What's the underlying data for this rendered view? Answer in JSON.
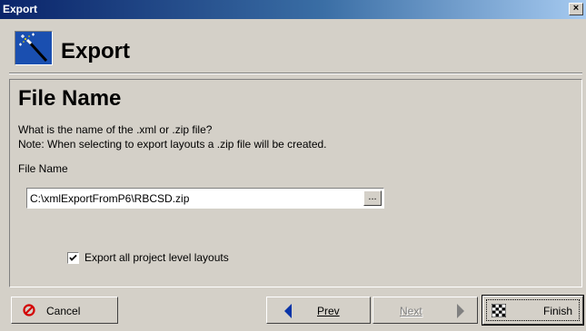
{
  "window": {
    "title": "Export",
    "close_label": "×"
  },
  "header": {
    "title": "Export"
  },
  "page": {
    "title": "File Name",
    "question": "What is the name of the .xml or .zip file?",
    "note": "Note: When selecting to export layouts a .zip file will be created.",
    "field_label": "File Name",
    "file_path": "C:\\xmlExportFromP6\\RBCSD.zip",
    "browse_label": "...",
    "checkbox_label": "Export all project level layouts",
    "checkbox_checked": true
  },
  "buttons": {
    "cancel": "Cancel",
    "prev": "Prev",
    "next": "Next",
    "finish": "Finish"
  },
  "colors": {
    "title_bar": "#0a246a",
    "face": "#d4d0c8",
    "cancel_icon": "#d40000",
    "arrow": "#0a34a8"
  },
  "icons": [
    "wizard-wand-icon",
    "close-icon",
    "cancel-icon",
    "prev-arrow-icon",
    "next-arrow-icon",
    "finish-flag-icon",
    "checkmark-icon"
  ]
}
